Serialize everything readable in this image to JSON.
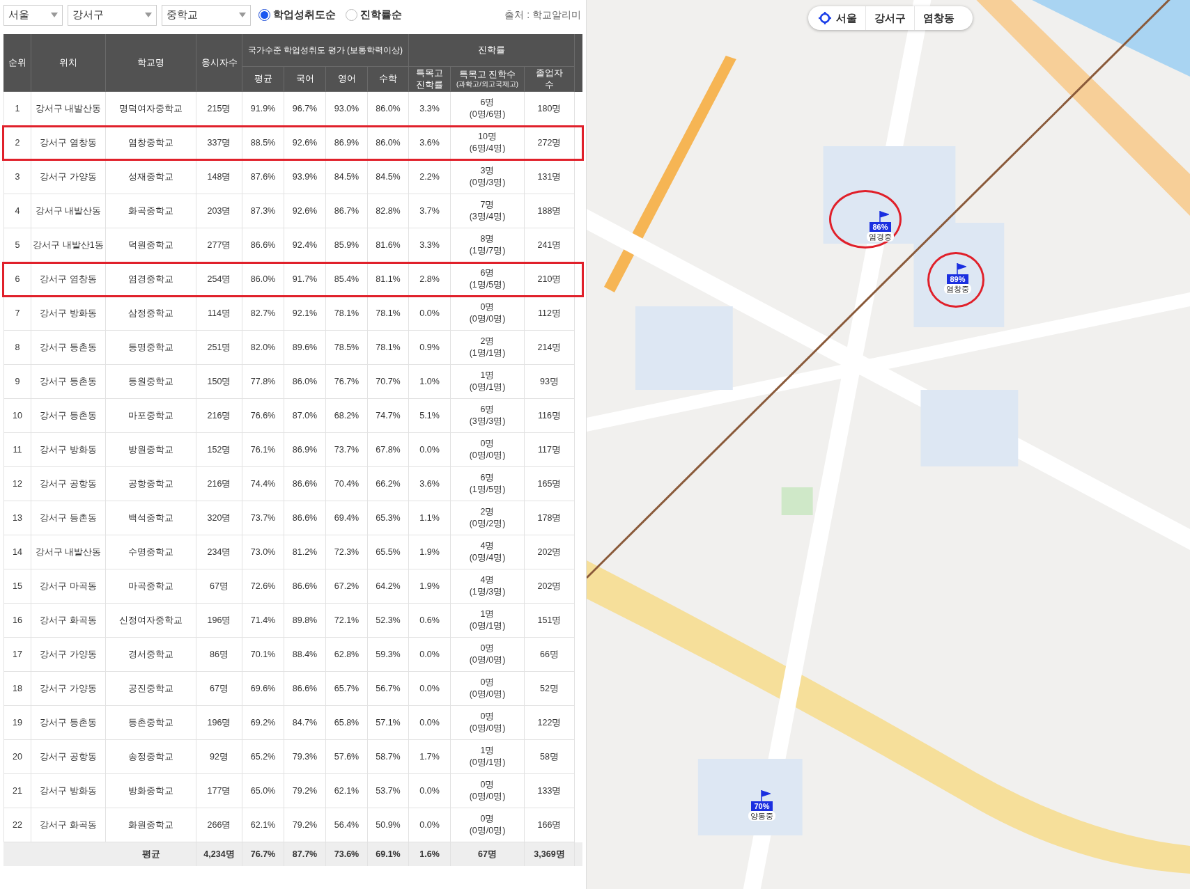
{
  "filters": [
    {
      "value": "서울"
    },
    {
      "value": "강서구"
    },
    {
      "value": "중학교"
    }
  ],
  "sort_options": [
    {
      "label": "학업성취도순",
      "selected": true
    },
    {
      "label": "진학률순",
      "selected": false
    }
  ],
  "source": "출처 : 학교알리미",
  "table": {
    "header": {
      "rank": "순위",
      "location": "위치",
      "school": "학교명",
      "takers": "응시자수",
      "achievement_group": "국가수준 학업성취도 평가 (보통학력이상)",
      "average": "평균",
      "korean": "국어",
      "english": "영어",
      "math": "수학",
      "advancement_group": "진학률",
      "special_rate": "특목고\n진학률",
      "special_count": "특목고 진학수",
      "special_count_note": "(과학고/외고국제고)",
      "graduates": "졸업자\n수"
    },
    "rows": [
      {
        "rank": "1",
        "location": "강서구 내발산동",
        "school": "명덕여자중학교",
        "takers": "215명",
        "average": "91.9%",
        "korean": "96.7%",
        "english": "93.0%",
        "math": "86.0%",
        "special_rate": "3.3%",
        "special_count": "6명",
        "special_detail": "(0명/6명)",
        "graduates": "180명",
        "highlighted": false
      },
      {
        "rank": "2",
        "location": "강서구 염창동",
        "school": "염창중학교",
        "takers": "337명",
        "average": "88.5%",
        "korean": "92.6%",
        "english": "86.9%",
        "math": "86.0%",
        "special_rate": "3.6%",
        "special_count": "10명",
        "special_detail": "(6명/4명)",
        "graduates": "272명",
        "highlighted": true
      },
      {
        "rank": "3",
        "location": "강서구 가양동",
        "school": "성재중학교",
        "takers": "148명",
        "average": "87.6%",
        "korean": "93.9%",
        "english": "84.5%",
        "math": "84.5%",
        "special_rate": "2.2%",
        "special_count": "3명",
        "special_detail": "(0명/3명)",
        "graduates": "131명",
        "highlighted": false
      },
      {
        "rank": "4",
        "location": "강서구 내발산동",
        "school": "화곡중학교",
        "takers": "203명",
        "average": "87.3%",
        "korean": "92.6%",
        "english": "86.7%",
        "math": "82.8%",
        "special_rate": "3.7%",
        "special_count": "7명",
        "special_detail": "(3명/4명)",
        "graduates": "188명",
        "highlighted": false
      },
      {
        "rank": "5",
        "location": "강서구 내발산1동",
        "school": "덕원중학교",
        "takers": "277명",
        "average": "86.6%",
        "korean": "92.4%",
        "english": "85.9%",
        "math": "81.6%",
        "special_rate": "3.3%",
        "special_count": "8명",
        "special_detail": "(1명/7명)",
        "graduates": "241명",
        "highlighted": false
      },
      {
        "rank": "6",
        "location": "강서구 염창동",
        "school": "염경중학교",
        "takers": "254명",
        "average": "86.0%",
        "korean": "91.7%",
        "english": "85.4%",
        "math": "81.1%",
        "special_rate": "2.8%",
        "special_count": "6명",
        "special_detail": "(1명/5명)",
        "graduates": "210명",
        "highlighted": true
      },
      {
        "rank": "7",
        "location": "강서구 방화동",
        "school": "삼정중학교",
        "takers": "114명",
        "average": "82.7%",
        "korean": "92.1%",
        "english": "78.1%",
        "math": "78.1%",
        "special_rate": "0.0%",
        "special_count": "0명",
        "special_detail": "(0명/0명)",
        "graduates": "112명",
        "highlighted": false
      },
      {
        "rank": "8",
        "location": "강서구 등촌동",
        "school": "등명중학교",
        "takers": "251명",
        "average": "82.0%",
        "korean": "89.6%",
        "english": "78.5%",
        "math": "78.1%",
        "special_rate": "0.9%",
        "special_count": "2명",
        "special_detail": "(1명/1명)",
        "graduates": "214명",
        "highlighted": false
      },
      {
        "rank": "9",
        "location": "강서구 등촌동",
        "school": "등원중학교",
        "takers": "150명",
        "average": "77.8%",
        "korean": "86.0%",
        "english": "76.7%",
        "math": "70.7%",
        "special_rate": "1.0%",
        "special_count": "1명",
        "special_detail": "(0명/1명)",
        "graduates": "93명",
        "highlighted": false
      },
      {
        "rank": "10",
        "location": "강서구 등촌동",
        "school": "마포중학교",
        "takers": "216명",
        "average": "76.6%",
        "korean": "87.0%",
        "english": "68.2%",
        "math": "74.7%",
        "special_rate": "5.1%",
        "special_count": "6명",
        "special_detail": "(3명/3명)",
        "graduates": "116명",
        "highlighted": false
      },
      {
        "rank": "11",
        "location": "강서구 방화동",
        "school": "방원중학교",
        "takers": "152명",
        "average": "76.1%",
        "korean": "86.9%",
        "english": "73.7%",
        "math": "67.8%",
        "special_rate": "0.0%",
        "special_count": "0명",
        "special_detail": "(0명/0명)",
        "graduates": "117명",
        "highlighted": false
      },
      {
        "rank": "12",
        "location": "강서구 공항동",
        "school": "공항중학교",
        "takers": "216명",
        "average": "74.4%",
        "korean": "86.6%",
        "english": "70.4%",
        "math": "66.2%",
        "special_rate": "3.6%",
        "special_count": "6명",
        "special_detail": "(1명/5명)",
        "graduates": "165명",
        "highlighted": false
      },
      {
        "rank": "13",
        "location": "강서구 등촌동",
        "school": "백석중학교",
        "takers": "320명",
        "average": "73.7%",
        "korean": "86.6%",
        "english": "69.4%",
        "math": "65.3%",
        "special_rate": "1.1%",
        "special_count": "2명",
        "special_detail": "(0명/2명)",
        "graduates": "178명",
        "highlighted": false
      },
      {
        "rank": "14",
        "location": "강서구 내발산동",
        "school": "수명중학교",
        "takers": "234명",
        "average": "73.0%",
        "korean": "81.2%",
        "english": "72.3%",
        "math": "65.5%",
        "special_rate": "1.9%",
        "special_count": "4명",
        "special_detail": "(0명/4명)",
        "graduates": "202명",
        "highlighted": false
      },
      {
        "rank": "15",
        "location": "강서구 마곡동",
        "school": "마곡중학교",
        "takers": "67명",
        "average": "72.6%",
        "korean": "86.6%",
        "english": "67.2%",
        "math": "64.2%",
        "special_rate": "1.9%",
        "special_count": "4명",
        "special_detail": "(1명/3명)",
        "graduates": "202명",
        "highlighted": false
      },
      {
        "rank": "16",
        "location": "강서구 화곡동",
        "school": "신정여자중학교",
        "takers": "196명",
        "average": "71.4%",
        "korean": "89.8%",
        "english": "72.1%",
        "math": "52.3%",
        "special_rate": "0.6%",
        "special_count": "1명",
        "special_detail": "(0명/1명)",
        "graduates": "151명",
        "highlighted": false
      },
      {
        "rank": "17",
        "location": "강서구 가양동",
        "school": "경서중학교",
        "takers": "86명",
        "average": "70.1%",
        "korean": "88.4%",
        "english": "62.8%",
        "math": "59.3%",
        "special_rate": "0.0%",
        "special_count": "0명",
        "special_detail": "(0명/0명)",
        "graduates": "66명",
        "highlighted": false
      },
      {
        "rank": "18",
        "location": "강서구 가양동",
        "school": "공진중학교",
        "takers": "67명",
        "average": "69.6%",
        "korean": "86.6%",
        "english": "65.7%",
        "math": "56.7%",
        "special_rate": "0.0%",
        "special_count": "0명",
        "special_detail": "(0명/0명)",
        "graduates": "52명",
        "highlighted": false
      },
      {
        "rank": "19",
        "location": "강서구 등촌동",
        "school": "등촌중학교",
        "takers": "196명",
        "average": "69.2%",
        "korean": "84.7%",
        "english": "65.8%",
        "math": "57.1%",
        "special_rate": "0.0%",
        "special_count": "0명",
        "special_detail": "(0명/0명)",
        "graduates": "122명",
        "highlighted": false
      },
      {
        "rank": "20",
        "location": "강서구 공항동",
        "school": "송정중학교",
        "takers": "92명",
        "average": "65.2%",
        "korean": "79.3%",
        "english": "57.6%",
        "math": "58.7%",
        "special_rate": "1.7%",
        "special_count": "1명",
        "special_detail": "(0명/1명)",
        "graduates": "58명",
        "highlighted": false
      },
      {
        "rank": "21",
        "location": "강서구 방화동",
        "school": "방화중학교",
        "takers": "177명",
        "average": "65.0%",
        "korean": "79.2%",
        "english": "62.1%",
        "math": "53.7%",
        "special_rate": "0.0%",
        "special_count": "0명",
        "special_detail": "(0명/0명)",
        "graduates": "133명",
        "highlighted": false
      },
      {
        "rank": "22",
        "location": "강서구 화곡동",
        "school": "화원중학교",
        "takers": "266명",
        "average": "62.1%",
        "korean": "79.2%",
        "english": "56.4%",
        "math": "50.9%",
        "special_rate": "0.0%",
        "special_count": "0명",
        "special_detail": "(0명/0명)",
        "graduates": "166명",
        "highlighted": false
      }
    ],
    "summary": {
      "label": "평균",
      "takers": "4,234명",
      "average": "76.7%",
      "korean": "87.7%",
      "english": "73.6%",
      "math": "69.1%",
      "special_rate": "1.6%",
      "special_count": "67명",
      "graduates": "3,369명"
    }
  },
  "map": {
    "kind": "picture",
    "breadcrumb": [
      "서울",
      "강서구",
      "염창동"
    ],
    "markers": [
      {
        "percent": "86%",
        "name": "염경중",
        "circled": true
      },
      {
        "percent": "89%",
        "name": "염창중",
        "circled": true
      },
      {
        "percent": "70%",
        "name": "양동중",
        "circled": false
      }
    ]
  }
}
